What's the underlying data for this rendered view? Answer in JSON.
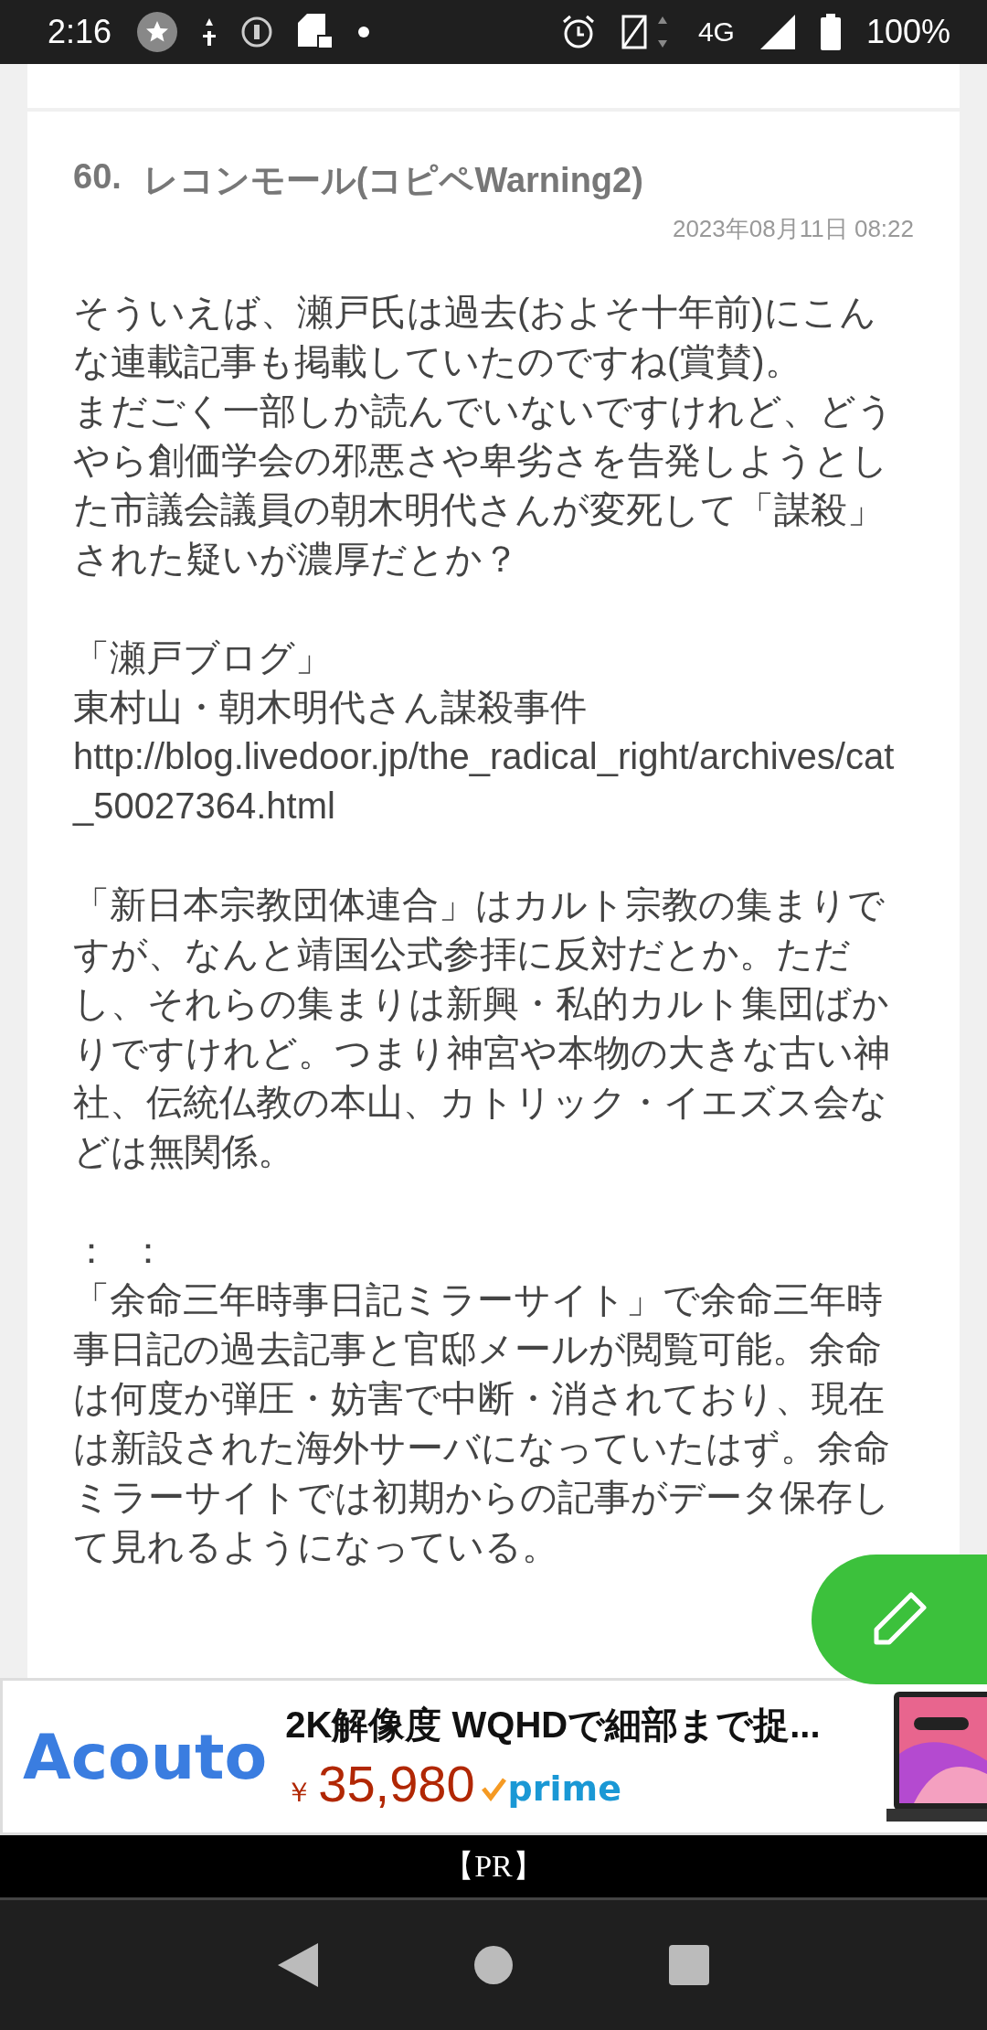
{
  "status_bar": {
    "time": "2:16",
    "network": "4G",
    "battery": "100%"
  },
  "post": {
    "number": "60.",
    "author": "レコンモール(コピペWarning2)",
    "date": "2023年08月11日 08:22",
    "blocks": [
      [
        "そういえば、瀬戸氏は過去(およそ十年前)にこんな連載記事も掲載していたのですね(賞賛)。",
        "まだごく一部しか読んでいないですけれど、どうやら創価学会の邪悪さや卑劣さを告発しようとした市議会議員の朝木明代さんが変死して「謀殺」された疑いが濃厚だとか？"
      ],
      [
        "「瀬戸ブログ」",
        "東村山・朝木明代さん謀殺事件",
        "http://blog.livedoor.jp/the_radical_right/archives/cat_50027364.html"
      ],
      [
        "「新日本宗教団体連合」はカルト宗教の集まりですが、なんと靖国公式参拝に反対だとか。ただし、それらの集まりは新興・私的カルト集団ばかりですけれど。つまり神宮や本物の大きな古い神社、伝統仏教の本山、カトリック・イエズス会などは無関係。"
      ],
      [
        "：  ：",
        "「余命三年時事日記ミラーサイト」で余命三年時事日記の過去記事と官邸メールが閲覧可能。余命は何度か弾圧・妨害で中断・消されており、現在は新設された海外サーバになっていたはず。余命ミラーサイトでは初期からの記事がデータ保存して見れるようになっている。"
      ]
    ]
  },
  "ad": {
    "brand": "Acouto",
    "title": "2K解像度 WQHDで細部まで捉...",
    "currency": "￥",
    "price": "35,980",
    "badge": "prime",
    "label": "【PR】"
  }
}
